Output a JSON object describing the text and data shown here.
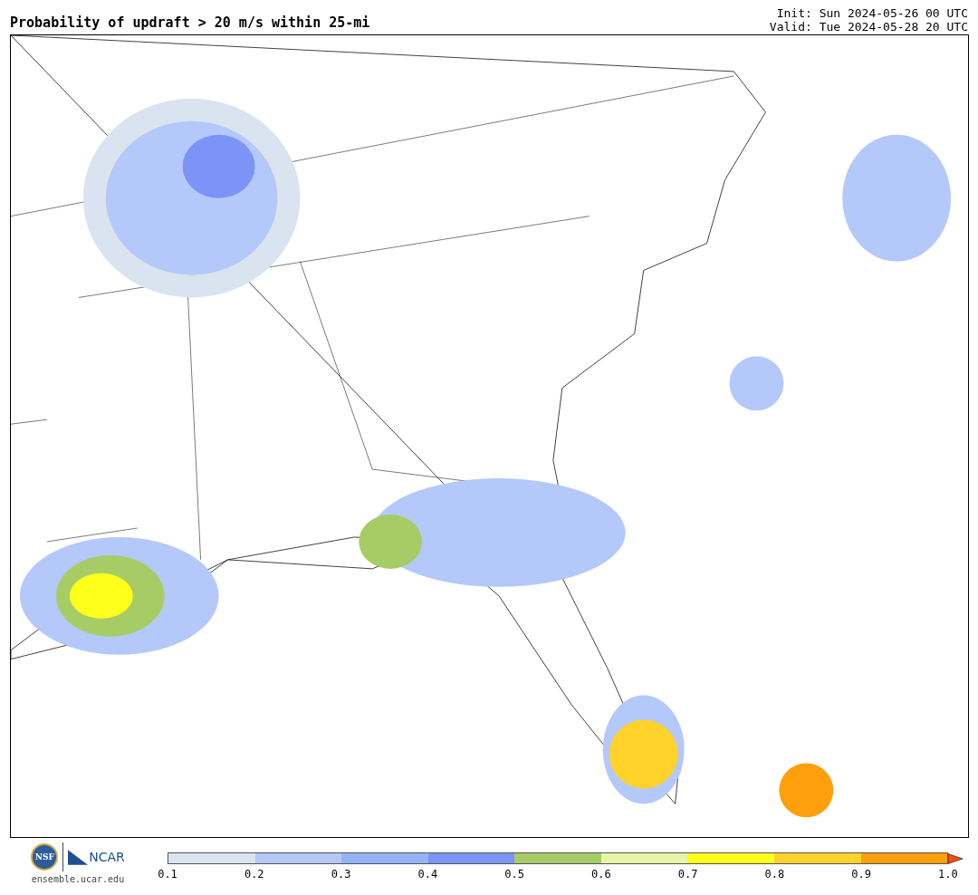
{
  "title": "Probability of updraft > 20 m/s within 25-mi",
  "init": "Init: Sun 2024-05-26 00 UTC",
  "valid": "Valid: Tue 2024-05-28 20 UTC",
  "footer": {
    "logo_nsf": "NSF",
    "logo_ncar": "NCAR",
    "site": "ensemble.ucar.edu"
  },
  "colorbar": {
    "bins": [
      {
        "color": "#d9e4f0"
      },
      {
        "color": "#b4c8fa"
      },
      {
        "color": "#94b4fa"
      },
      {
        "color": "#7b94f5"
      },
      {
        "color": "#a7cc66"
      },
      {
        "color": "#e8f5a8"
      },
      {
        "color": "#ffff1c"
      },
      {
        "color": "#ffd22c"
      },
      {
        "color": "#ff9f0c"
      }
    ],
    "extend": {
      "color": "#ff4a0a"
    },
    "ticks": [
      "0.1",
      "0.2",
      "0.3",
      "0.4",
      "0.5",
      "0.6",
      "0.7",
      "0.8",
      "0.9",
      "1.0"
    ]
  }
}
